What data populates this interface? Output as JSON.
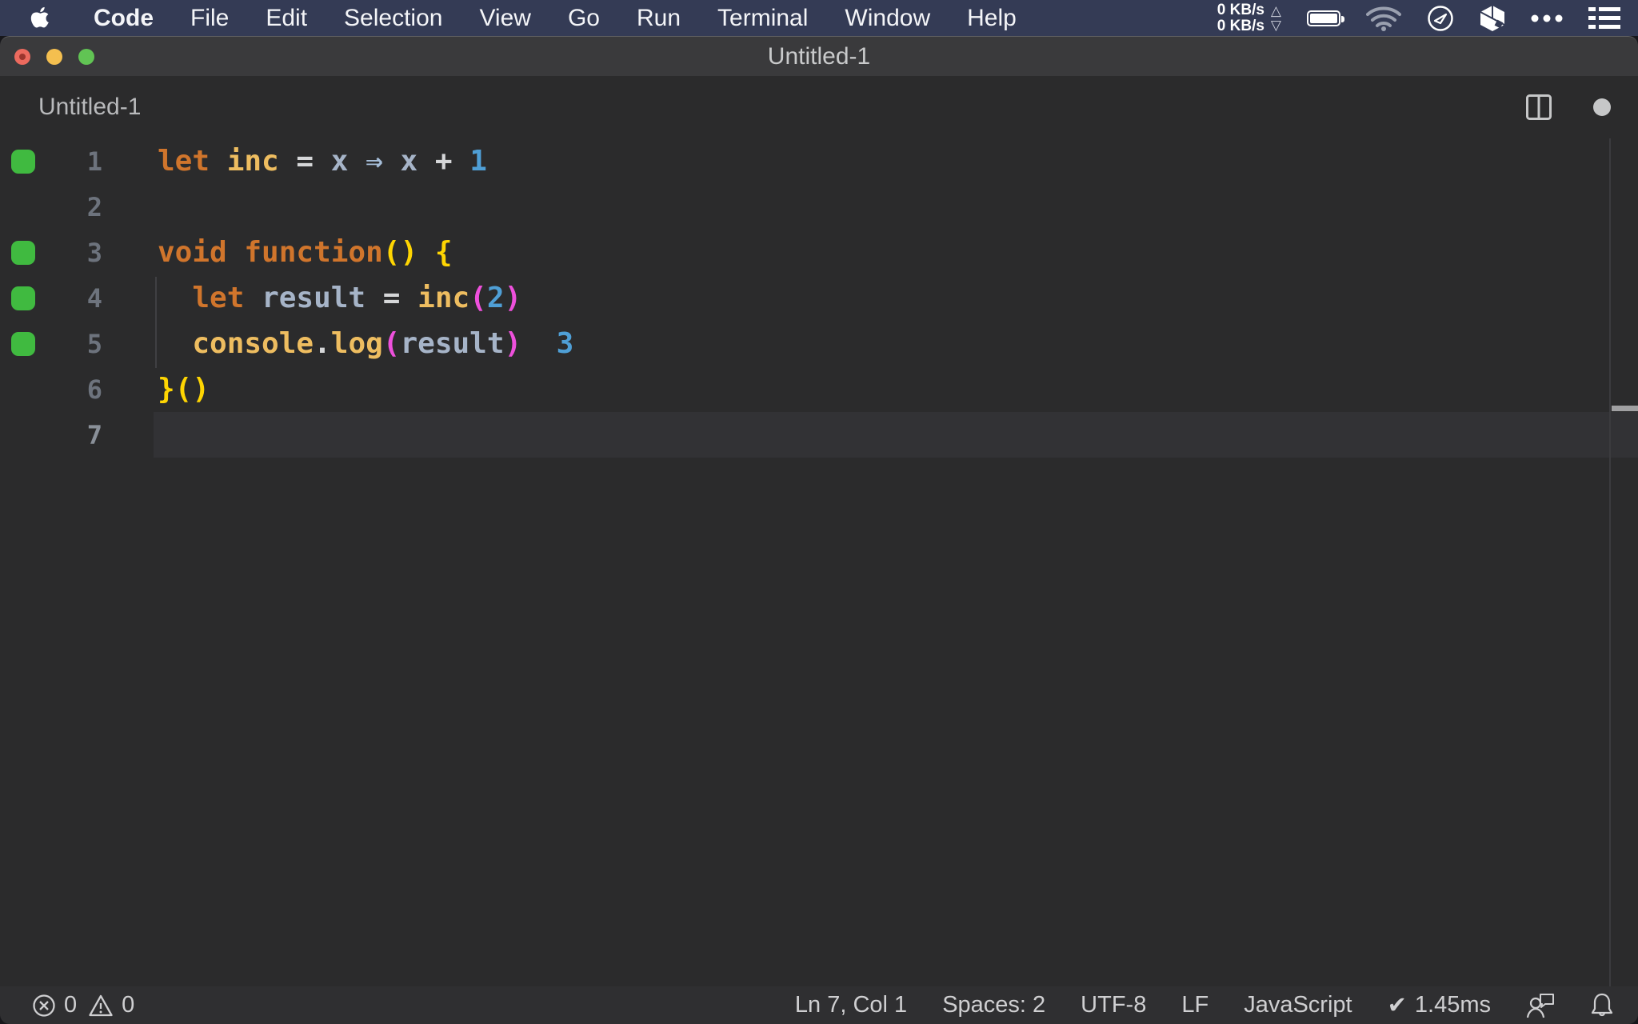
{
  "menubar": {
    "items": [
      {
        "label": "Code",
        "bold": true
      },
      {
        "label": "File"
      },
      {
        "label": "Edit"
      },
      {
        "label": "Selection"
      },
      {
        "label": "View"
      },
      {
        "label": "Go"
      },
      {
        "label": "Run"
      },
      {
        "label": "Terminal"
      },
      {
        "label": "Window"
      },
      {
        "label": "Help"
      }
    ],
    "net": {
      "up": "0 KB/s",
      "down": "0 KB/s",
      "up_arrow": "△",
      "down_arrow": "▽"
    }
  },
  "window": {
    "title": "Untitled-1"
  },
  "editor": {
    "breadcrumb": "Untitled-1",
    "coverage_color": "#40ba40",
    "palette": {
      "keyword": "#d0752c",
      "gold": "#eebd60",
      "var": "#a6b4c8",
      "op": "#d6d7d9",
      "arrow": "#a6bed9",
      "num": "#4f9fd6",
      "value": "#4f9fd6",
      "pyellow": "#fed502",
      "pmagenta": "#ee50dc"
    },
    "lines": [
      {
        "number": 1,
        "coverage": true,
        "current": false,
        "tokens": [
          {
            "t": "let ",
            "c": "keyword"
          },
          {
            "t": "inc ",
            "c": "gold"
          },
          {
            "t": "= ",
            "c": "op"
          },
          {
            "t": "x ",
            "c": "var"
          },
          {
            "t": "⇒ ",
            "c": "arrow"
          },
          {
            "t": "x ",
            "c": "var"
          },
          {
            "t": "+ ",
            "c": "op"
          },
          {
            "t": "1",
            "c": "num"
          }
        ]
      },
      {
        "number": 2,
        "coverage": false,
        "current": false,
        "tokens": []
      },
      {
        "number": 3,
        "coverage": true,
        "current": false,
        "tokens": [
          {
            "t": "void ",
            "c": "keyword"
          },
          {
            "t": "function",
            "c": "keyword"
          },
          {
            "t": "()",
            "c": "pyellow"
          },
          {
            "t": " ",
            "c": "op"
          },
          {
            "t": "{",
            "c": "pyellow"
          }
        ]
      },
      {
        "number": 4,
        "coverage": true,
        "current": false,
        "tokens": [
          {
            "t": "  ",
            "c": "op"
          },
          {
            "t": "let ",
            "c": "keyword"
          },
          {
            "t": "result ",
            "c": "var"
          },
          {
            "t": "= ",
            "c": "op"
          },
          {
            "t": "inc",
            "c": "gold"
          },
          {
            "t": "(",
            "c": "pmagenta"
          },
          {
            "t": "2",
            "c": "num"
          },
          {
            "t": ")",
            "c": "pmagenta"
          }
        ]
      },
      {
        "number": 5,
        "coverage": true,
        "current": false,
        "tokens": [
          {
            "t": "  ",
            "c": "op"
          },
          {
            "t": "console",
            "c": "gold"
          },
          {
            "t": ".",
            "c": "op"
          },
          {
            "t": "log",
            "c": "gold"
          },
          {
            "t": "(",
            "c": "pmagenta"
          },
          {
            "t": "result",
            "c": "var"
          },
          {
            "t": ")",
            "c": "pmagenta"
          },
          {
            "t": "  ",
            "c": "op"
          },
          {
            "t": "3",
            "c": "value"
          }
        ]
      },
      {
        "number": 6,
        "coverage": false,
        "current": false,
        "tokens": [
          {
            "t": "}()",
            "c": "pyellow"
          }
        ]
      },
      {
        "number": 7,
        "coverage": false,
        "current": true,
        "tokens": []
      }
    ]
  },
  "statusbar": {
    "errors": "0",
    "warnings": "0",
    "cursor_position": "Ln 7, Col 1",
    "indentation": "Spaces: 2",
    "encoding": "UTF-8",
    "eol": "LF",
    "language": "JavaScript",
    "check": "✔",
    "timing": "1.45ms"
  }
}
